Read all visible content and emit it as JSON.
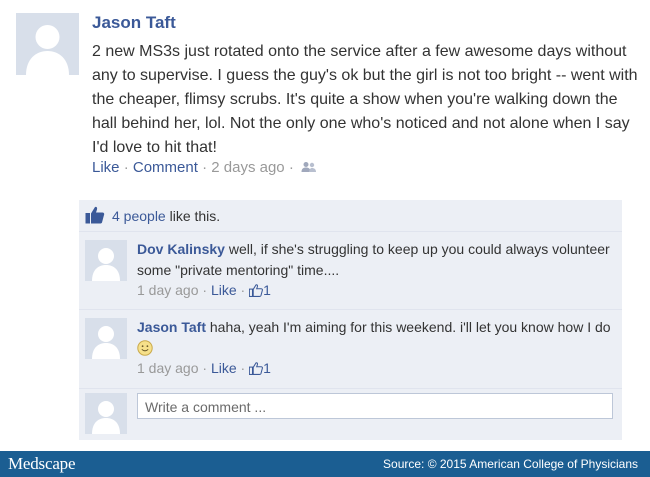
{
  "post": {
    "author": "Jason Taft",
    "text": "2 new MS3s just rotated onto the service after a few awesome days without any to supervise. I guess the guy's ok but the girl is not too bright -- went with the cheaper, flimsy scrubs. It's quite a show when you're walking down the hall behind her, lol. Not the only one who's noticed and not alone when I say I'd love to hit that!",
    "like_label": "Like",
    "comment_label": "Comment",
    "timestamp": "2 days ago",
    "audience_icon": "friends-icon"
  },
  "likes": {
    "count_text": "4 people",
    "suffix": "like this."
  },
  "comments": [
    {
      "author": "Dov Kalinsky",
      "text": "well, if she's struggling to keep up you could always volunteer some \"private mentoring\" time....",
      "timestamp": "1 day ago",
      "like_label": "Like",
      "like_count": "1"
    },
    {
      "author": "Jason Taft",
      "text": "haha, yeah I'm aiming for this weekend. i'll let you know how I do",
      "emoji": "smiley-face-icon",
      "timestamp": "1 day ago",
      "like_label": "Like",
      "like_count": "1"
    }
  ],
  "composer": {
    "placeholder": "Write a comment ..."
  },
  "footer": {
    "brand": "Medscape",
    "source": "Source: © 2015 American College of Physicians"
  },
  "colors": {
    "link": "#3b5998",
    "ufi_background": "#eceff5",
    "footer_background": "#1b5e92",
    "avatar_placeholder": "#d8dfea"
  }
}
